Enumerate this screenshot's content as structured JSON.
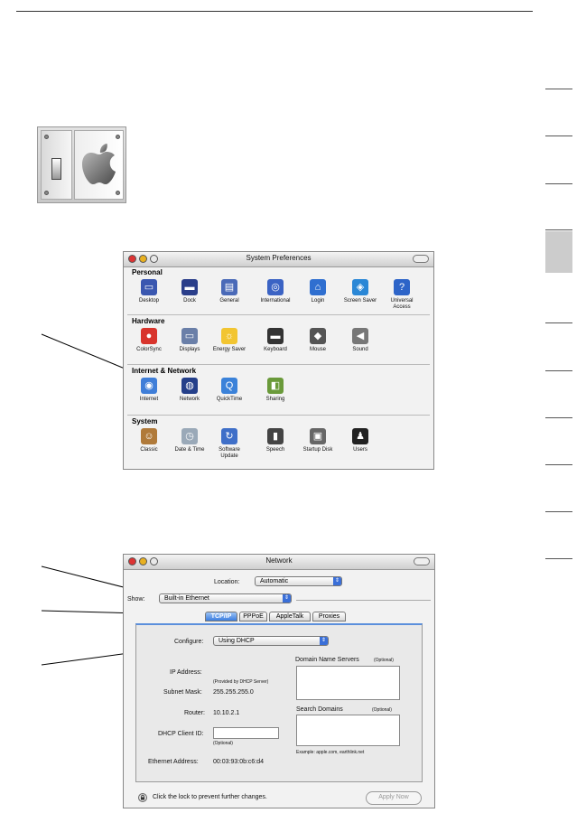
{
  "system_prefs": {
    "title": "System Preferences",
    "categories": [
      {
        "name": "Personal",
        "items": [
          {
            "label": "Desktop",
            "icon": "desktop-icon",
            "color": "#3a57b0"
          },
          {
            "label": "Dock",
            "icon": "dock-icon",
            "color": "#2a3e8a"
          },
          {
            "label": "General",
            "icon": "general-icon",
            "color": "#4a6ab8"
          },
          {
            "label": "International",
            "icon": "international-icon",
            "color": "#3b63c4"
          },
          {
            "label": "Login",
            "icon": "login-icon",
            "color": "#2f6fd0"
          },
          {
            "label": "Screen Saver",
            "icon": "screen-saver-icon",
            "color": "#2a87d6"
          },
          {
            "label": "Universal Access",
            "icon": "universal-access-icon",
            "color": "#2d64c8"
          }
        ]
      },
      {
        "name": "Hardware",
        "items": [
          {
            "label": "ColorSync",
            "icon": "colorsync-icon",
            "color": "#d8342c"
          },
          {
            "label": "Displays",
            "icon": "displays-icon",
            "color": "#6a7fa8"
          },
          {
            "label": "Energy Saver",
            "icon": "energy-saver-icon",
            "color": "#f2c531"
          },
          {
            "label": "Keyboard",
            "icon": "keyboard-icon",
            "color": "#333333"
          },
          {
            "label": "Mouse",
            "icon": "mouse-icon",
            "color": "#555555"
          },
          {
            "label": "Sound",
            "icon": "sound-icon",
            "color": "#777777"
          }
        ]
      },
      {
        "name": "Internet & Network",
        "items": [
          {
            "label": "Internet",
            "icon": "internet-icon",
            "color": "#3f7ed8"
          },
          {
            "label": "Network",
            "icon": "network-icon",
            "color": "#243f8a"
          },
          {
            "label": "QuickTime",
            "icon": "quicktime-icon",
            "color": "#3b82d9"
          },
          {
            "label": "Sharing",
            "icon": "sharing-icon",
            "color": "#6a9a3a"
          }
        ]
      },
      {
        "name": "System",
        "items": [
          {
            "label": "Classic",
            "icon": "classic-icon",
            "color": "#b07a3a"
          },
          {
            "label": "Date & Time",
            "icon": "date-time-icon",
            "color": "#9aa9b8"
          },
          {
            "label": "Software Update",
            "icon": "software-update-icon",
            "color": "#3f6fc8"
          },
          {
            "label": "Speech",
            "icon": "speech-icon",
            "color": "#444444"
          },
          {
            "label": "Startup Disk",
            "icon": "startup-disk-icon",
            "color": "#666666"
          },
          {
            "label": "Users",
            "icon": "users-icon",
            "color": "#222222"
          }
        ]
      }
    ]
  },
  "network": {
    "title": "Network",
    "location_label": "Location:",
    "location_value": "Automatic",
    "show_label": "Show:",
    "show_value": "Built-in Ethernet",
    "tabs": [
      "TCP/IP",
      "PPPoE",
      "AppleTalk",
      "Proxies"
    ],
    "configure_label": "Configure:",
    "configure_value": "Using DHCP",
    "dns_label": "Domain Name Servers",
    "optional": "(Optional)",
    "ip_label": "IP Address:",
    "ip_note": "(Provided by DHCP Server)",
    "subnet_label": "Subnet Mask:",
    "subnet_value": "255.255.255.0",
    "router_label": "Router:",
    "router_value": "10.10.2.1",
    "search_label": "Search Domains",
    "dhcp_label": "DHCP Client ID:",
    "dhcp_optional": "(Optional)",
    "example": "Example: apple.com, earthlink.net",
    "ethernet_label": "Ethernet Address:",
    "ethernet_value": "00:03:93:0b:c6:d4",
    "lock_text": "Click the lock to prevent further changes.",
    "apply_label": "Apply Now"
  }
}
